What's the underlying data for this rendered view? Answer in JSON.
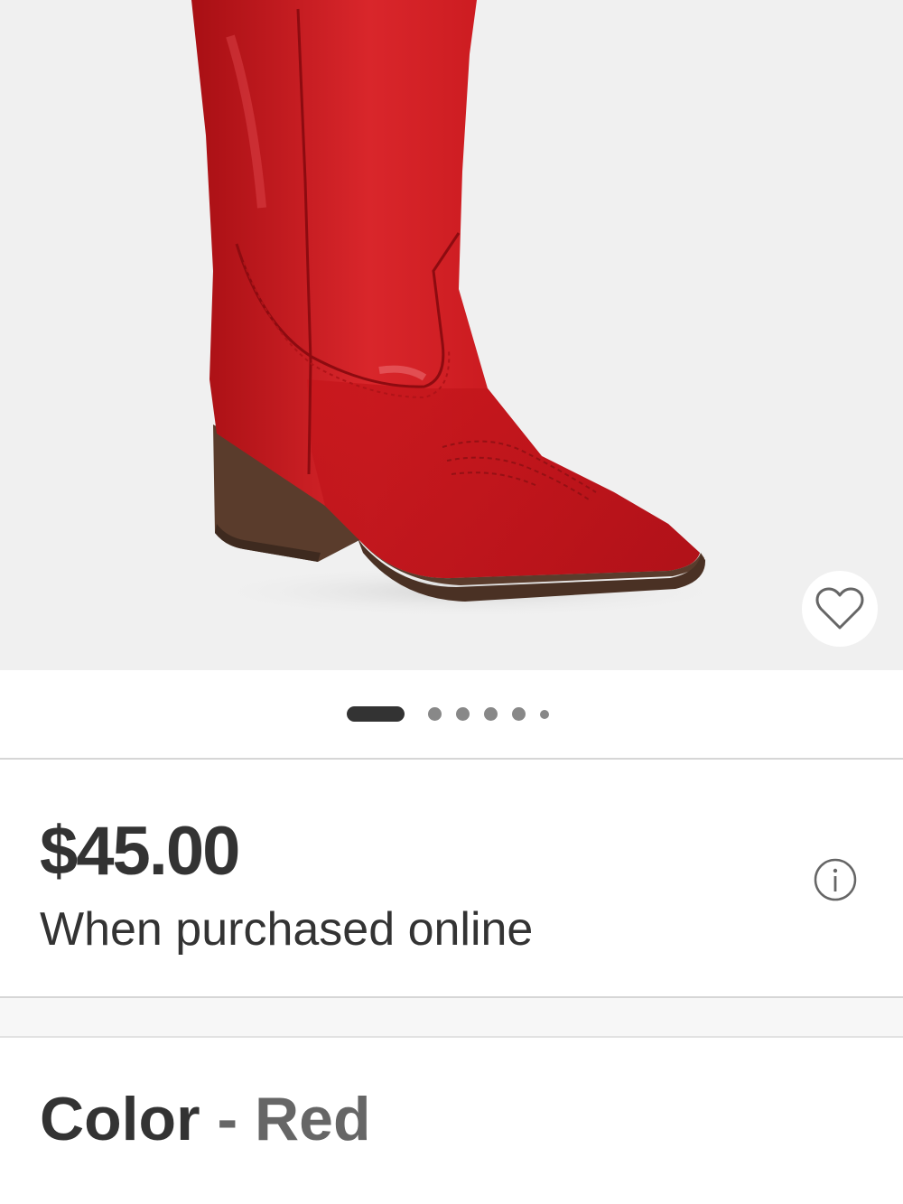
{
  "product": {
    "price": "$45.00",
    "price_note": "When purchased online",
    "image_alt": "Red western boot"
  },
  "carousel": {
    "total_slides": 6,
    "active_index": 0
  },
  "color": {
    "label": "Color",
    "separator": "-",
    "value": "Red"
  },
  "icons": {
    "favorite": "heart-icon",
    "info": "info-icon"
  },
  "colors": {
    "boot_red": "#c8171c",
    "sole_brown": "#5a3c2c",
    "background": "#f0f0f0",
    "text_dark": "#333333",
    "text_muted": "#666666"
  }
}
